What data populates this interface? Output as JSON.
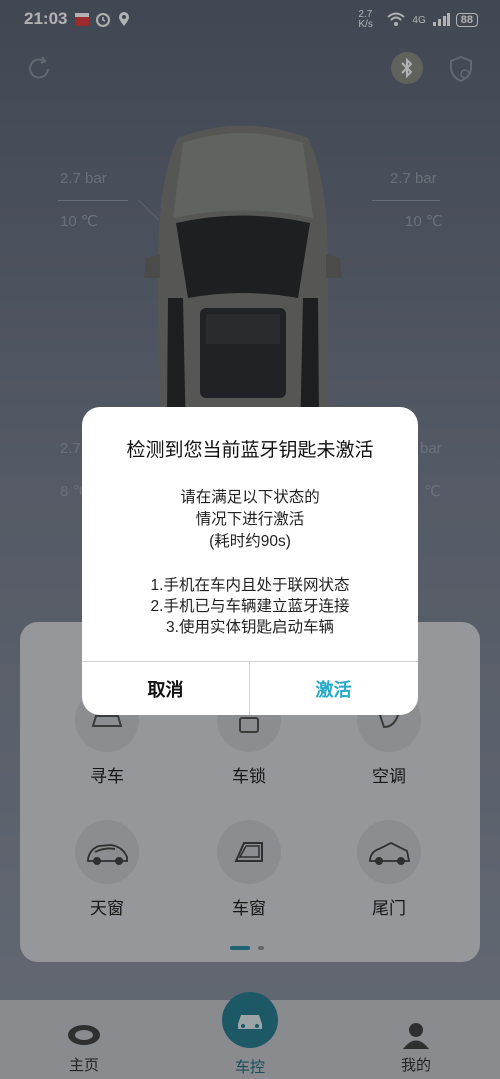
{
  "status_bar": {
    "time": "21:03",
    "net_speed": "2.7 K/s",
    "signal": "4G",
    "battery": "88"
  },
  "tires": {
    "front_left": {
      "pressure": "2.7 bar",
      "temp": "10 ℃"
    },
    "front_right": {
      "pressure": "2.7 bar",
      "temp": "10 ℃"
    },
    "rear_left": {
      "pressure": "2.7",
      "temp": "8 ℃"
    },
    "rear_right": {
      "pressure": "bar",
      "temp": "℃"
    }
  },
  "dialog": {
    "title": "检测到您当前蓝牙钥匙未激活",
    "desc_line1": "请在满足以下状态的",
    "desc_line2": "情况下进行激活",
    "desc_line3": "(耗时约90s)",
    "step1": "1.手机在车内且处于联网状态",
    "step2": "2.手机已与车辆建立蓝牙连接",
    "step3": "3.使用实体钥匙启动车辆",
    "cancel_label": "取消",
    "activate_label": "激活"
  },
  "controls": {
    "find_car": "寻车",
    "lock": "车锁",
    "ac": "空调",
    "sunroof": "天窗",
    "window": "车窗",
    "tailgate": "尾门"
  },
  "nav": {
    "home": "主页",
    "control": "车控",
    "mine": "我的"
  },
  "colors": {
    "accent": "#24a9c9",
    "nav_active": "#2a7f93"
  }
}
